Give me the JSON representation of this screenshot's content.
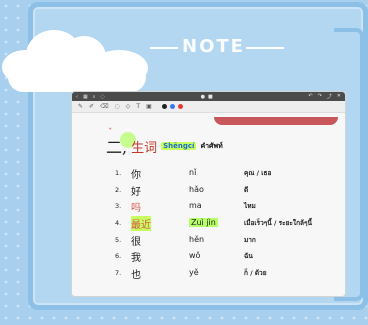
{
  "decor": {
    "note_label": "NOTE"
  },
  "app": {
    "titlebar": {
      "left": [
        "‹",
        "▦",
        "⌕",
        "◌"
      ],
      "center": [
        "●",
        "■"
      ],
      "right": [
        "↶",
        "↷",
        "⤴",
        "✕"
      ]
    },
    "toolbar_icons": [
      "pen",
      "eraser",
      "lasso",
      "shapes",
      "text",
      "ruler",
      "image"
    ],
    "pen_colors": [
      "#222222",
      "#3b78e7",
      "#e53935"
    ]
  },
  "lesson": {
    "section_number": "二,",
    "section_title_cn": "生词",
    "section_title_pinyin": "Shēngcí",
    "section_title_thai": "คำศัพท์",
    "words": [
      {
        "num": "1.",
        "cn": "你",
        "pinyin": "nǐ",
        "thai": "คุณ / เธอ"
      },
      {
        "num": "2.",
        "cn": "好",
        "pinyin": "hǎo",
        "thai": "ดี"
      },
      {
        "num": "3.",
        "cn": "吗",
        "pinyin": "ma",
        "thai": "ไหม"
      },
      {
        "num": "4.",
        "cn": "最近",
        "pinyin": "Zuì jìn",
        "thai": "เมื่อเร็วๆนี้ / ระยะใกล้ๆนี้"
      },
      {
        "num": "5.",
        "cn": "很",
        "pinyin": "hěn",
        "thai": "มาก"
      },
      {
        "num": "6.",
        "cn": "我",
        "pinyin": "wǒ",
        "thai": "ฉัน"
      },
      {
        "num": "7.",
        "cn": "也",
        "pinyin": "yě",
        "thai": "ก็ / ด้วย"
      }
    ]
  },
  "colors": {
    "accent_red": "#c0392b",
    "highlight_green": "#b6ff6a",
    "pinyin_blue": "#1a6bd0"
  }
}
